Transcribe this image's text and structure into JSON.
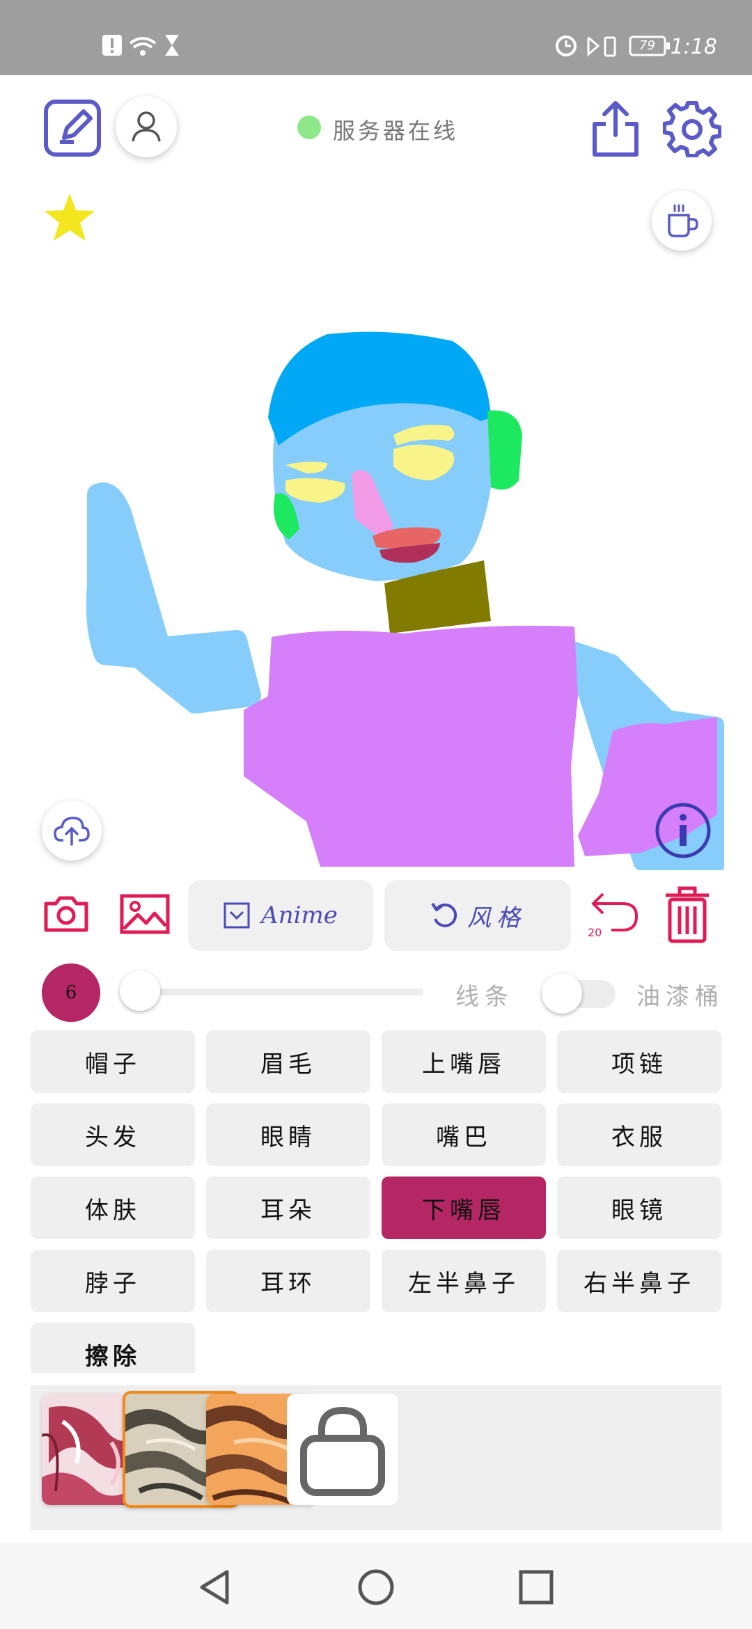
{
  "status_bar": {
    "time": "1:18",
    "battery": "79"
  },
  "header": {
    "server_status": "服务器在线"
  },
  "toolbar": {
    "anime_label": "Anime",
    "style_label": "风格",
    "undo_count": "20"
  },
  "brush": {
    "size": "6",
    "line_label": "线条",
    "bucket_label": "油漆桶",
    "slider_value": 0,
    "bucket_on": false
  },
  "parts": [
    {
      "label": "帽子",
      "selected": false
    },
    {
      "label": "眉毛",
      "selected": false
    },
    {
      "label": "上嘴唇",
      "selected": false
    },
    {
      "label": "项链",
      "selected": false
    },
    {
      "label": "头发",
      "selected": false
    },
    {
      "label": "眼睛",
      "selected": false
    },
    {
      "label": "嘴巴",
      "selected": false
    },
    {
      "label": "衣服",
      "selected": false
    },
    {
      "label": "体肤",
      "selected": false
    },
    {
      "label": "耳朵",
      "selected": false
    },
    {
      "label": "下嘴唇",
      "selected": true
    },
    {
      "label": "眼镜",
      "selected": false
    },
    {
      "label": "脖子",
      "selected": false
    },
    {
      "label": "耳环",
      "selected": false
    },
    {
      "label": "左半鼻子",
      "selected": false
    },
    {
      "label": "右半鼻子",
      "selected": false
    },
    {
      "label": "擦除",
      "selected": false
    }
  ],
  "styles": [
    {
      "name": "style-red-marble",
      "selected": false
    },
    {
      "name": "style-gray-zebra",
      "selected": true
    },
    {
      "name": "style-orange-tiger",
      "selected": false
    },
    {
      "name": "store-locked",
      "selected": false
    }
  ],
  "colors": {
    "accent": "#b52764",
    "icon_purple": "#5a5ac8",
    "red_icon": "#e01b55",
    "star": "#f3e51e"
  }
}
